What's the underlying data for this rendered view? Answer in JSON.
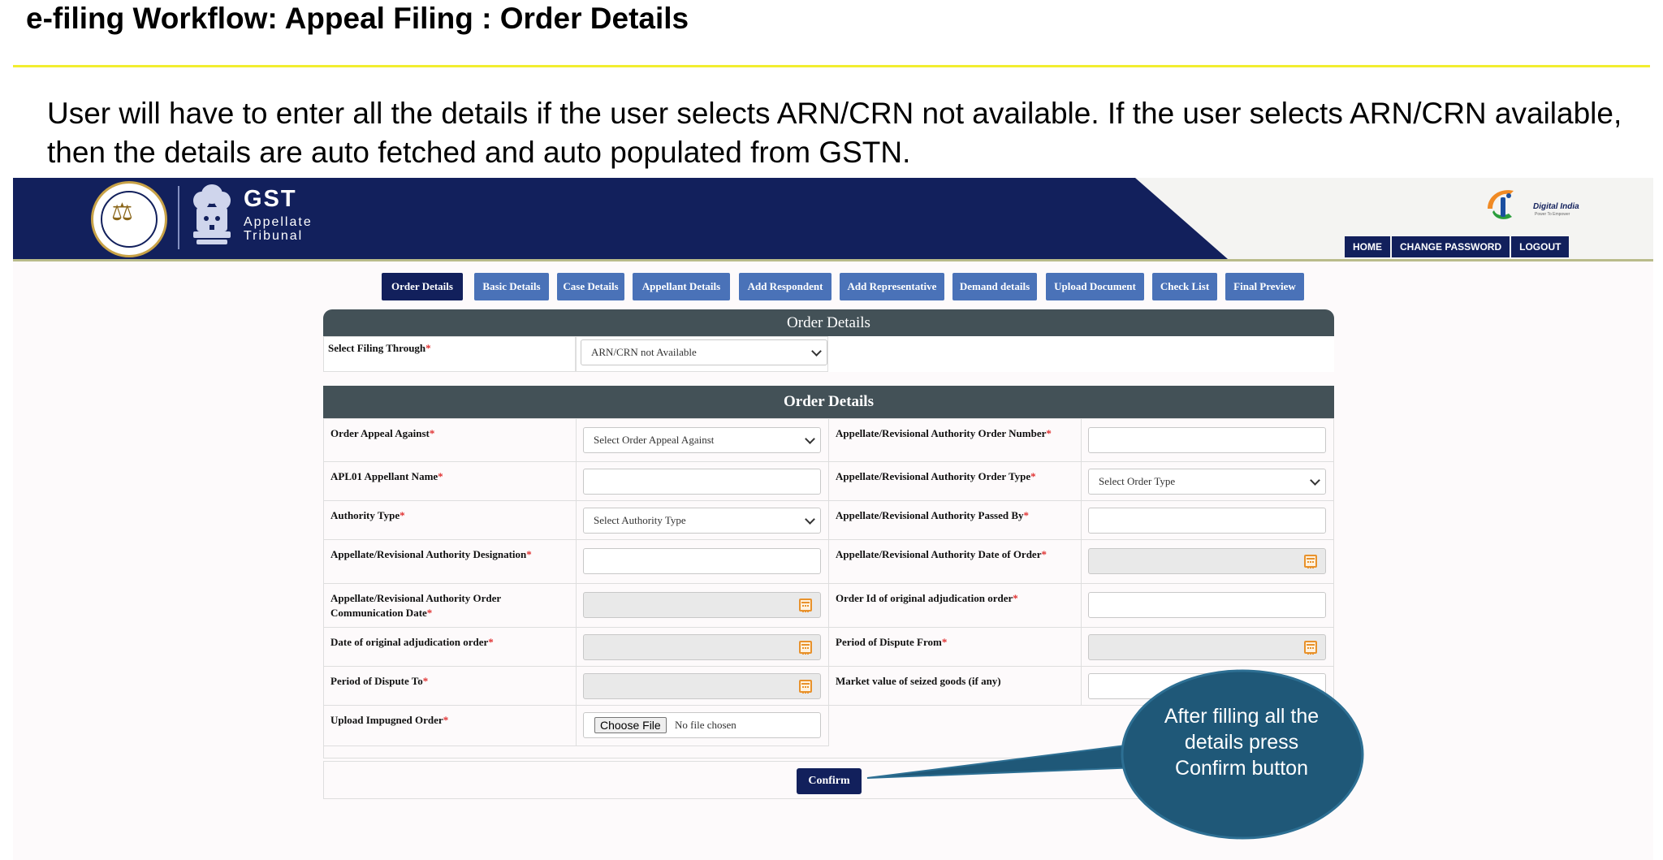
{
  "slide": {
    "title": "e-filing Workflow: Appeal Filing : Order Details",
    "description": "User will have to enter all the details if the user selects ARN/CRN not available. If the user selects ARN/CRN available, then the details are auto fetched and auto populated from GSTN."
  },
  "header": {
    "logo_title": "GST",
    "logo_line1": "Appellate",
    "logo_line2": "Tribunal",
    "digital_india": "Digital India",
    "digital_india_tagline": "Power To Empower",
    "nav": [
      "HOME",
      "CHANGE PASSWORD",
      "LOGOUT"
    ]
  },
  "tabs": [
    "Order Details",
    "Basic Details",
    "Case Details",
    "Appellant Details",
    "Add Respondent",
    "Add Representative",
    "Demand details",
    "Upload Document",
    "Check List",
    "Final Preview"
  ],
  "active_tab": "Order Details",
  "filing": {
    "panel_title": "Order Details",
    "label": "Select Filing Through",
    "value": "ARN/CRN not Available"
  },
  "order_details": {
    "section_title": "Order Details",
    "fields": [
      {
        "label": "Order Appeal Against",
        "value": "Select Order Appeal Against",
        "type": "select"
      },
      {
        "label": "Appellate/Revisional Authority Order Number",
        "value": "",
        "type": "text"
      },
      {
        "label": "APL01 Appellant Name",
        "value": "",
        "type": "text"
      },
      {
        "label": "Appellate/Revisional Authority Order Type",
        "value": "Select Order Type",
        "type": "select"
      },
      {
        "label": "Authority Type",
        "value": "Select Authority Type",
        "type": "select"
      },
      {
        "label": "Appellate/Revisional Authority Passed By",
        "value": "",
        "type": "text"
      },
      {
        "label": "Appellate/Revisional Authority Designation",
        "value": "",
        "type": "text"
      },
      {
        "label": "Appellate/Revisional Authority Date of Order",
        "value": "",
        "type": "date"
      },
      {
        "label": "Appellate/Revisional Authority Order Communication Date",
        "value": "",
        "type": "date"
      },
      {
        "label": "Order Id of original adjudication order",
        "value": "",
        "type": "text"
      },
      {
        "label": "Date of original adjudication order",
        "value": "",
        "type": "date"
      },
      {
        "label": "Period of Dispute From",
        "value": "",
        "type": "date"
      },
      {
        "label": "Period of Dispute To",
        "value": "",
        "type": "date"
      },
      {
        "label": "Market value of seized goods (if any)",
        "value": "",
        "type": "text",
        "required": false
      },
      {
        "label": "Upload Impugned Order",
        "value": "No file chosen",
        "button": "Choose File",
        "type": "file"
      }
    ]
  },
  "confirm_label": "Confirm",
  "callout_text": "After filling all the details press Confirm button",
  "colors": {
    "navy": "#12205c",
    "tab_blue": "#4a72b8",
    "section_gray": "#435157",
    "callout_teal": "#1f5878",
    "required_red": "#e03030",
    "title_rule_yellow": "#f2ee30"
  }
}
